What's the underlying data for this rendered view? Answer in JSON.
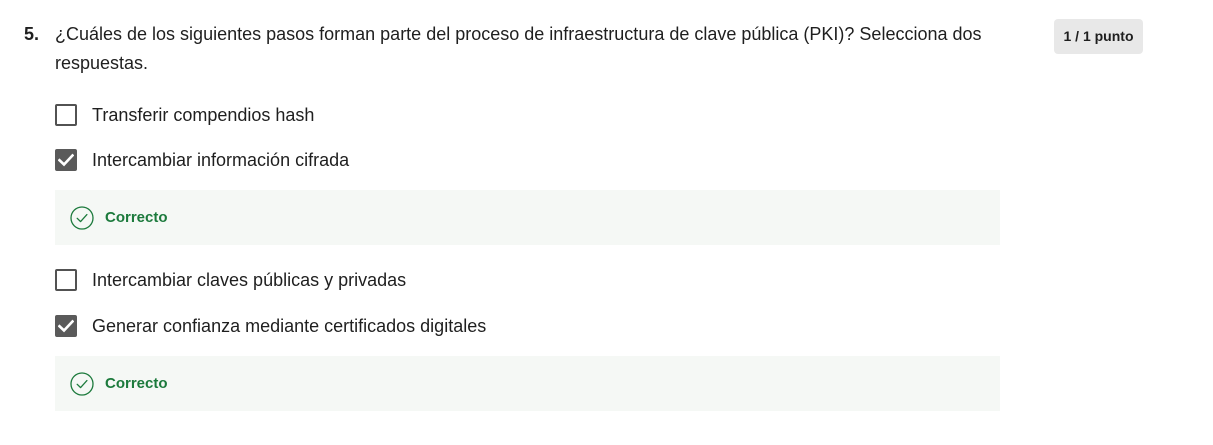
{
  "question": {
    "number": "5.",
    "text": "¿Cuáles de los siguientes pasos forman parte del proceso de infraestructura de clave pública (PKI)? Selecciona dos respuestas.",
    "points": "1 / 1 punto"
  },
  "options": [
    {
      "label": "Transferir compendios hash",
      "checked": false
    },
    {
      "label": "Intercambiar información cifrada",
      "checked": true,
      "feedback": "Correcto"
    },
    {
      "label": "Intercambiar claves públicas y privadas",
      "checked": false
    },
    {
      "label": "Generar confianza mediante certificados digitales",
      "checked": true,
      "feedback": "Correcto"
    }
  ],
  "colors": {
    "checkbox_checked": "#5a5a5a",
    "correct_text": "#1c7a3c",
    "feedback_background": "#f5f8f5",
    "badge_background": "#e8e8e8"
  },
  "icons": {
    "checkmark": "checkmark-icon",
    "correct": "check-circle-icon"
  }
}
